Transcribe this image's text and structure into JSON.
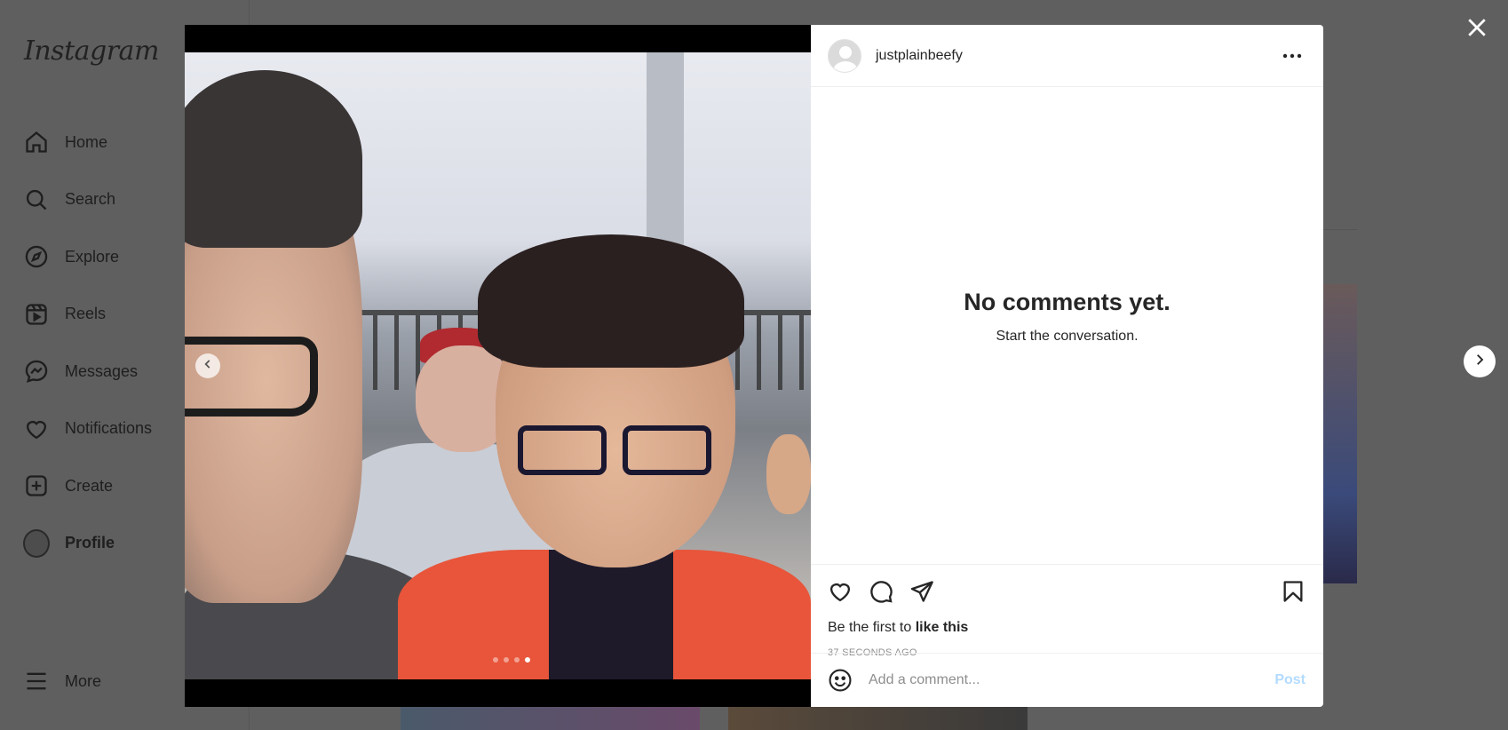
{
  "sidebar": {
    "logo": "Instagram",
    "items": [
      {
        "label": "Home",
        "icon": "home-icon"
      },
      {
        "label": "Search",
        "icon": "search-icon"
      },
      {
        "label": "Explore",
        "icon": "compass-icon"
      },
      {
        "label": "Reels",
        "icon": "reels-icon"
      },
      {
        "label": "Messages",
        "icon": "messenger-icon"
      },
      {
        "label": "Notifications",
        "icon": "heart-icon"
      },
      {
        "label": "Create",
        "icon": "plus-square-icon"
      },
      {
        "label": "Profile",
        "icon": "avatar"
      }
    ],
    "more_label": "More"
  },
  "post": {
    "username": "justplainbeefy",
    "carousel": {
      "total": 4,
      "current": 4
    },
    "no_comments_title": "No comments yet.",
    "no_comments_sub": "Start the conversation.",
    "likes_prefix": "Be the first to ",
    "likes_link": "like this",
    "timestamp": "37 SECONDS AGO",
    "comment_placeholder": "Add a comment...",
    "post_label": "Post"
  },
  "colors": {
    "overlay": "#5f5f5f",
    "post_button": "#b3dbff",
    "muted_text": "#8e8e8e"
  }
}
